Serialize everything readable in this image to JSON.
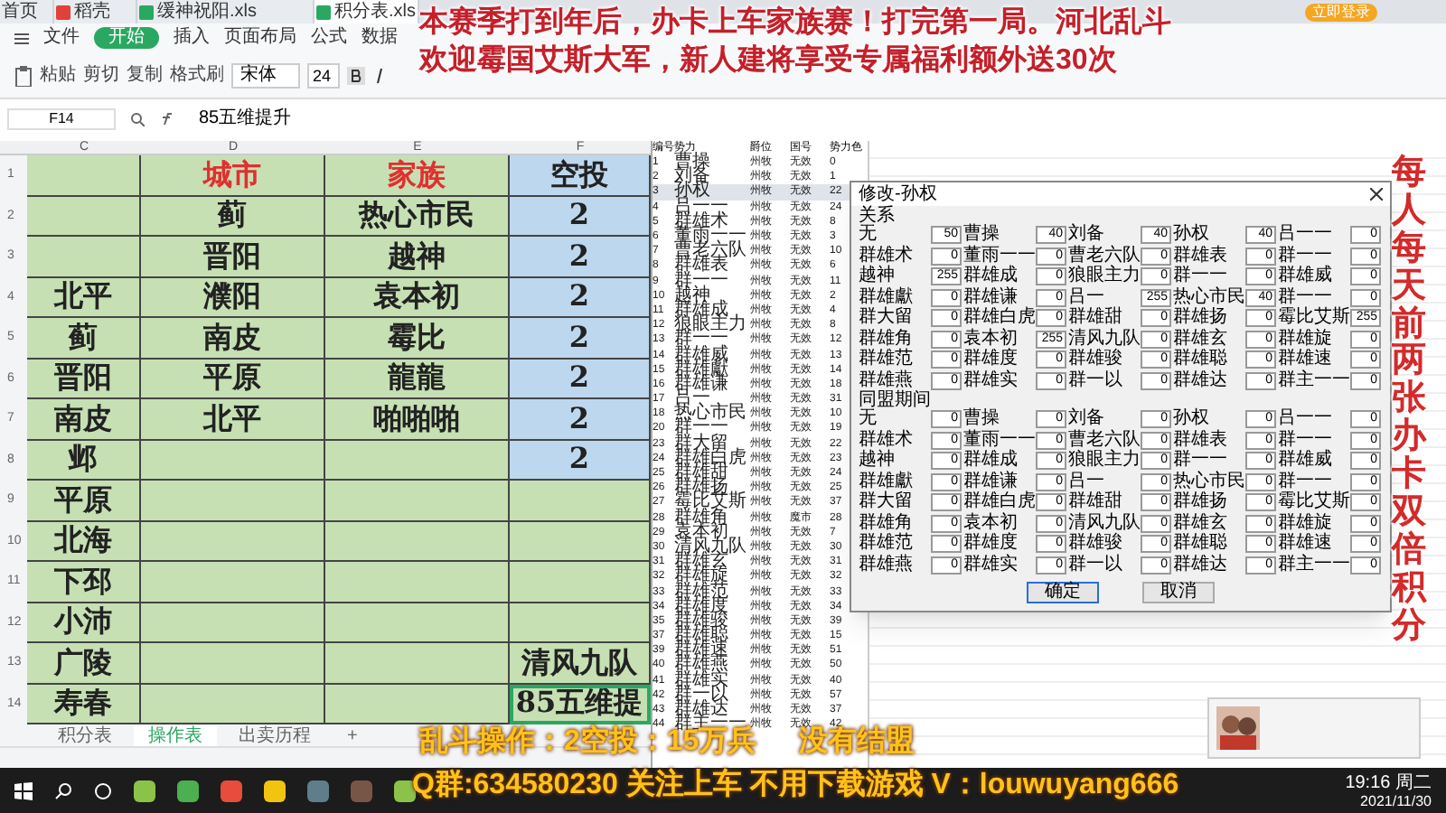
{
  "browser_tabs": [
    {
      "label": "首页",
      "selected": false
    },
    {
      "label": "稻壳",
      "selected": false
    },
    {
      "label": "缓神祝阳.xls",
      "selected": false
    },
    {
      "label": "积分表.xls",
      "selected": true
    }
  ],
  "login_button": "立即登录",
  "ribbon_tabs": [
    {
      "label": "文件",
      "selected": false
    },
    {
      "label": "开始",
      "selected": true
    },
    {
      "label": "插入",
      "selected": false
    },
    {
      "label": "页面布局",
      "selected": false
    },
    {
      "label": "公式",
      "selected": false
    },
    {
      "label": "数据",
      "selected": false
    }
  ],
  "tools": [
    "粘贴",
    "剪切",
    "复制",
    "格式刷"
  ],
  "font": {
    "name": "宋体",
    "size": "24"
  },
  "formula_bar": {
    "cell": "F14",
    "value": "85五维提升"
  },
  "sheet": {
    "columns": [
      "C",
      "D",
      "E",
      "F"
    ],
    "rows": [
      {
        "number": "1",
        "kind": "header",
        "cells": [
          "",
          "城市",
          "家族",
          "空投"
        ],
        "highlight": true,
        "selected": false
      },
      {
        "number": "2",
        "kind": "data",
        "cells": [
          "",
          "蓟",
          "热心市民",
          "2"
        ],
        "highlight": true,
        "selected": false
      },
      {
        "number": "3",
        "kind": "data",
        "cells": [
          "",
          "晋阳",
          "越神",
          "2"
        ],
        "highlight": true,
        "selected": false
      },
      {
        "number": "4",
        "kind": "data",
        "cells": [
          "北平",
          "濮阳",
          "袁本初",
          "2"
        ],
        "highlight": true,
        "selected": false
      },
      {
        "number": "5",
        "kind": "data",
        "cells": [
          "蓟",
          "南皮",
          "霉比",
          "2"
        ],
        "highlight": true,
        "selected": false
      },
      {
        "number": "6",
        "kind": "data",
        "cells": [
          "晋阳",
          "平原",
          "龍龍",
          "2"
        ],
        "highlight": true,
        "selected": false
      },
      {
        "number": "7",
        "kind": "data",
        "cells": [
          "南皮",
          "北平",
          "啪啪啪",
          "2"
        ],
        "highlight": true,
        "selected": false
      },
      {
        "number": "8",
        "kind": "data",
        "cells": [
          "邺",
          "",
          "",
          "2"
        ],
        "highlight": true,
        "selected": false
      },
      {
        "number": "9",
        "kind": "data",
        "cells": [
          "平原",
          "",
          "",
          ""
        ],
        "highlight": false,
        "selected": false
      },
      {
        "number": "10",
        "kind": "data",
        "cells": [
          "北海",
          "",
          "",
          ""
        ],
        "highlight": false,
        "selected": false
      },
      {
        "number": "11",
        "kind": "data",
        "cells": [
          "下邳",
          "",
          "",
          ""
        ],
        "highlight": false,
        "selected": false
      },
      {
        "number": "12",
        "kind": "data",
        "cells": [
          "小沛",
          "",
          "",
          ""
        ],
        "highlight": false,
        "selected": false
      },
      {
        "number": "13",
        "kind": "data",
        "cells": [
          "广陵",
          "",
          "",
          "清风九队"
        ],
        "highlight": false,
        "selected": false
      },
      {
        "number": "14",
        "kind": "data",
        "cells": [
          "寿春",
          "",
          "",
          "85五维提"
        ],
        "highlight": false,
        "selected": true
      }
    ]
  },
  "sheet_tabs": [
    {
      "label": "积分表",
      "selected": false
    },
    {
      "label": "操作表",
      "selected": true
    },
    {
      "label": "出卖历程",
      "selected": false
    },
    {
      "label": "+",
      "selected": false
    }
  ],
  "force_list": {
    "columns": [
      "编号",
      "势力",
      "爵位",
      "国号",
      "势力色"
    ],
    "rows": [
      {
        "cells": [
          "1",
          "曹操",
          "州牧",
          "无效",
          "0"
        ],
        "selected": false
      },
      {
        "cells": [
          "2",
          "刘备",
          "州牧",
          "无效",
          "1"
        ],
        "selected": false
      },
      {
        "cells": [
          "3",
          "孙权",
          "州牧",
          "无效",
          "22"
        ],
        "selected": true
      },
      {
        "cells": [
          "4",
          "吕一一",
          "州牧",
          "无效",
          "24"
        ],
        "selected": false
      },
      {
        "cells": [
          "5",
          "群雄术",
          "州牧",
          "无效",
          "8"
        ],
        "selected": false
      },
      {
        "cells": [
          "6",
          "董雨一一",
          "州牧",
          "无效",
          "3"
        ],
        "selected": false
      },
      {
        "cells": [
          "7",
          "曹老六队",
          "州牧",
          "无效",
          "10"
        ],
        "selected": false
      },
      {
        "cells": [
          "8",
          "群雄表",
          "州牧",
          "无效",
          "6"
        ],
        "selected": false
      },
      {
        "cells": [
          "9",
          "群一一",
          "州牧",
          "无效",
          "11"
        ],
        "selected": false
      },
      {
        "cells": [
          "10",
          "越神",
          "州牧",
          "无效",
          "2"
        ],
        "selected": false
      },
      {
        "cells": [
          "11",
          "群雄成",
          "州牧",
          "无效",
          "4"
        ],
        "selected": false
      },
      {
        "cells": [
          "12",
          "狼眼主力",
          "州牧",
          "无效",
          "8"
        ],
        "selected": false
      },
      {
        "cells": [
          "13",
          "群一一",
          "州牧",
          "无效",
          "12"
        ],
        "selected": false
      },
      {
        "cells": [
          "14",
          "群雄威",
          "州牧",
          "无效",
          "13"
        ],
        "selected": false
      },
      {
        "cells": [
          "15",
          "群雄獻",
          "州牧",
          "无效",
          "14"
        ],
        "selected": false
      },
      {
        "cells": [
          "16",
          "群雄谦",
          "州牧",
          "无效",
          "18"
        ],
        "selected": false
      },
      {
        "cells": [
          "17",
          "吕一",
          "州牧",
          "无效",
          "31"
        ],
        "selected": false
      },
      {
        "cells": [
          "18",
          "热心市民",
          "州牧",
          "无效",
          "10"
        ],
        "selected": false
      },
      {
        "cells": [
          "20",
          "群一一",
          "州牧",
          "无效",
          "19"
        ],
        "selected": false
      },
      {
        "cells": [
          "23",
          "群大留",
          "州牧",
          "无效",
          "22"
        ],
        "selected": false
      },
      {
        "cells": [
          "24",
          "群雄白虎",
          "州牧",
          "无效",
          "23"
        ],
        "selected": false
      },
      {
        "cells": [
          "25",
          "群雄甜",
          "州牧",
          "无效",
          "24"
        ],
        "selected": false
      },
      {
        "cells": [
          "26",
          "群雄扬",
          "州牧",
          "无效",
          "25"
        ],
        "selected": false
      },
      {
        "cells": [
          "27",
          "霉比艾斯",
          "州牧",
          "无效",
          "37"
        ],
        "selected": false
      },
      {
        "cells": [
          "28",
          "群雄角",
          "州牧",
          "魔市",
          "28"
        ],
        "selected": false
      },
      {
        "cells": [
          "29",
          "袁本初",
          "州牧",
          "无效",
          "7"
        ],
        "selected": false
      },
      {
        "cells": [
          "30",
          "清风九队",
          "州牧",
          "无效",
          "30"
        ],
        "selected": false
      },
      {
        "cells": [
          "31",
          "群雄玄",
          "州牧",
          "无效",
          "31"
        ],
        "selected": false
      },
      {
        "cells": [
          "32",
          "群雄旋",
          "州牧",
          "无效",
          "32"
        ],
        "selected": false
      },
      {
        "cells": [
          "33",
          "群雄范",
          "州牧",
          "无效",
          "33"
        ],
        "selected": false
      },
      {
        "cells": [
          "34",
          "群雄度",
          "州牧",
          "无效",
          "34"
        ],
        "selected": false
      },
      {
        "cells": [
          "35",
          "群雄骏",
          "州牧",
          "无效",
          "39"
        ],
        "selected": false
      },
      {
        "cells": [
          "37",
          "群雄聪",
          "州牧",
          "无效",
          "15"
        ],
        "selected": false
      },
      {
        "cells": [
          "39",
          "群雄速",
          "州牧",
          "无效",
          "51"
        ],
        "selected": false
      },
      {
        "cells": [
          "40",
          "群雄燕",
          "州牧",
          "无效",
          "50"
        ],
        "selected": false
      },
      {
        "cells": [
          "41",
          "群雄实",
          "州牧",
          "无效",
          "40"
        ],
        "selected": false
      },
      {
        "cells": [
          "42",
          "群一以",
          "州牧",
          "无效",
          "57"
        ],
        "selected": false
      },
      {
        "cells": [
          "43",
          "群雄达",
          "州牧",
          "无效",
          "37"
        ],
        "selected": false
      },
      {
        "cells": [
          "44",
          "群主一一",
          "州牧",
          "无效",
          "42"
        ],
        "selected": false
      }
    ]
  },
  "dialog": {
    "title": "修改-孙权",
    "sections": [
      {
        "label": "关系",
        "fields": [
          {
            "label": "无",
            "value": "50"
          },
          {
            "label": "曹操",
            "value": "40"
          },
          {
            "label": "刘备",
            "value": "40"
          },
          {
            "label": "孙权",
            "value": "40"
          },
          {
            "label": "吕一一",
            "value": "0"
          },
          {
            "label": "群雄术",
            "value": "0"
          },
          {
            "label": "董雨一一",
            "value": "0"
          },
          {
            "label": "曹老六队",
            "value": "0"
          },
          {
            "label": "群雄表",
            "value": "0"
          },
          {
            "label": "群一一",
            "value": "0"
          },
          {
            "label": "越神",
            "value": "255"
          },
          {
            "label": "群雄成",
            "value": "0"
          },
          {
            "label": "狼眼主力",
            "value": "0"
          },
          {
            "label": "群一一",
            "value": "0"
          },
          {
            "label": "群雄威",
            "value": "0"
          },
          {
            "label": "群雄獻",
            "value": "0"
          },
          {
            "label": "群雄谦",
            "value": "0"
          },
          {
            "label": "吕一",
            "value": "255"
          },
          {
            "label": "热心市民",
            "value": "40"
          },
          {
            "label": "群一一",
            "value": "0"
          },
          {
            "label": "群大留",
            "value": "0"
          },
          {
            "label": "群雄白虎",
            "value": "0"
          },
          {
            "label": "群雄甜",
            "value": "0"
          },
          {
            "label": "群雄扬",
            "value": "0"
          },
          {
            "label": "霉比艾斯",
            "value": "255"
          },
          {
            "label": "群雄角",
            "value": "0"
          },
          {
            "label": "袁本初",
            "value": "255"
          },
          {
            "label": "清风九队",
            "value": "0"
          },
          {
            "label": "群雄玄",
            "value": "0"
          },
          {
            "label": "群雄旋",
            "value": "0"
          },
          {
            "label": "群雄范",
            "value": "0"
          },
          {
            "label": "群雄度",
            "value": "0"
          },
          {
            "label": "群雄骏",
            "value": "0"
          },
          {
            "label": "群雄聪",
            "value": "0"
          },
          {
            "label": "群雄速",
            "value": "0"
          },
          {
            "label": "群雄燕",
            "value": "0"
          },
          {
            "label": "群雄实",
            "value": "0"
          },
          {
            "label": "群一以",
            "value": "0"
          },
          {
            "label": "群雄达",
            "value": "0"
          },
          {
            "label": "群主一一",
            "value": "0"
          }
        ]
      },
      {
        "label": "同盟期间",
        "fields": [
          {
            "label": "无",
            "value": "0"
          },
          {
            "label": "曹操",
            "value": "0"
          },
          {
            "label": "刘备",
            "value": "0"
          },
          {
            "label": "孙权",
            "value": "0"
          },
          {
            "label": "吕一一",
            "value": "0"
          },
          {
            "label": "群雄术",
            "value": "0"
          },
          {
            "label": "董雨一一",
            "value": "0"
          },
          {
            "label": "曹老六队",
            "value": "0"
          },
          {
            "label": "群雄表",
            "value": "0"
          },
          {
            "label": "群一一",
            "value": "0"
          },
          {
            "label": "越神",
            "value": "0"
          },
          {
            "label": "群雄成",
            "value": "0"
          },
          {
            "label": "狼眼主力",
            "value": "0"
          },
          {
            "label": "群一一",
            "value": "0"
          },
          {
            "label": "群雄威",
            "value": "0"
          },
          {
            "label": "群雄獻",
            "value": "0"
          },
          {
            "label": "群雄谦",
            "value": "0"
          },
          {
            "label": "吕一",
            "value": "0"
          },
          {
            "label": "热心市民",
            "value": "0"
          },
          {
            "label": "群一一",
            "value": "0"
          },
          {
            "label": "群大留",
            "value": "0"
          },
          {
            "label": "群雄白虎",
            "value": "0"
          },
          {
            "label": "群雄甜",
            "value": "0"
          },
          {
            "label": "群雄扬",
            "value": "0"
          },
          {
            "label": "霉比艾斯",
            "value": "0"
          },
          {
            "label": "群雄角",
            "value": "0"
          },
          {
            "label": "袁本初",
            "value": "0"
          },
          {
            "label": "清风九队",
            "value": "0"
          },
          {
            "label": "群雄玄",
            "value": "0"
          },
          {
            "label": "群雄旋",
            "value": "0"
          },
          {
            "label": "群雄范",
            "value": "0"
          },
          {
            "label": "群雄度",
            "value": "0"
          },
          {
            "label": "群雄骏",
            "value": "0"
          },
          {
            "label": "群雄聪",
            "value": "0"
          },
          {
            "label": "群雄速",
            "value": "0"
          },
          {
            "label": "群雄燕",
            "value": "0"
          },
          {
            "label": "群雄实",
            "value": "0"
          },
          {
            "label": "群一以",
            "value": "0"
          },
          {
            "label": "群雄达",
            "value": "0"
          },
          {
            "label": "群主一一",
            "value": "0"
          }
        ]
      }
    ],
    "buttons": [
      "确定",
      "取消"
    ]
  },
  "overlays": {
    "top": [
      "本赛季打到年后，办卡上车家族赛！打完第一局。河北乱斗",
      "欢迎霉国艾斯大军，新人建将享受专属福利额外送30次"
    ],
    "right": "每人每天前两张办卡双倍积分",
    "bottom": [
      "乱斗操作：2空投：15万兵",
      "没有结盟",
      "Q群:634580230 关注上车 不用下载游戏 V：louwuyang666"
    ]
  },
  "taskbar": {
    "time": "19:16 周二",
    "date": "2021/11/30"
  }
}
